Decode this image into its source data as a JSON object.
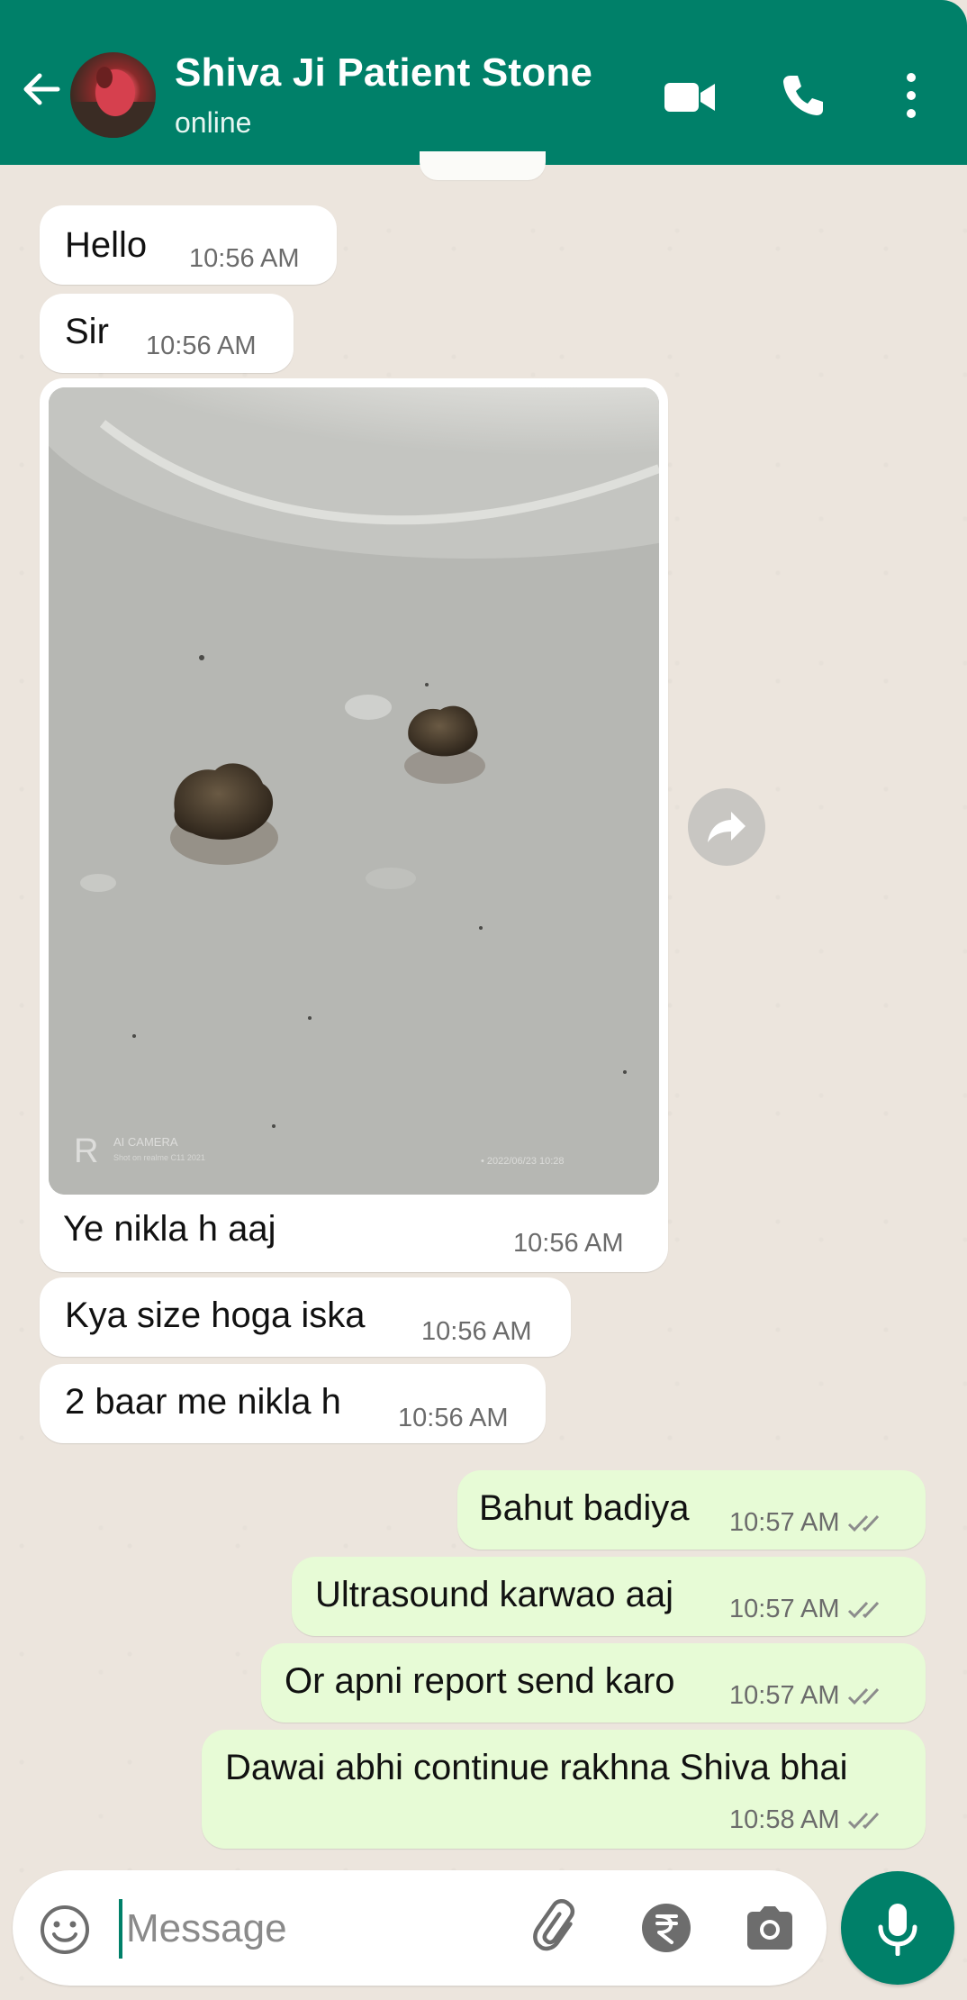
{
  "header": {
    "contact_name": "Shiva Ji Patient Stone",
    "status": "online",
    "icons": [
      "back-arrow-icon",
      "video-call-icon",
      "phone-call-icon",
      "more-options-icon"
    ],
    "color": "#008069"
  },
  "messages": [
    {
      "direction": "incoming",
      "text": "Hello",
      "time": "10:56 AM"
    },
    {
      "direction": "incoming",
      "text": "Sir",
      "time": "10:56 AM"
    },
    {
      "direction": "incoming",
      "type": "image",
      "caption": "Ye nikla h aaj",
      "time": "10:56 AM",
      "image_watermark": {
        "brand": "AI CAMERA",
        "sub": "Shot on realme C11 2021",
        "stamp": "2022/06/23  10:28"
      }
    },
    {
      "direction": "incoming",
      "text": "Kya size hoga iska",
      "time": "10:56 AM"
    },
    {
      "direction": "incoming",
      "text": "2 baar me nikla h",
      "time": "10:56 AM"
    },
    {
      "direction": "outgoing",
      "text": "Bahut badiya",
      "time": "10:57 AM",
      "read": true
    },
    {
      "direction": "outgoing",
      "text": "Ultrasound karwao aaj",
      "time": "10:57 AM",
      "read": true
    },
    {
      "direction": "outgoing",
      "text": "Or apni report send karo",
      "time": "10:57 AM",
      "read": true
    },
    {
      "direction": "outgoing",
      "text": "Dawai abhi continue rakhna Shiva bhai",
      "time": "10:58 AM",
      "read": true
    }
  ],
  "composer": {
    "placeholder": "Message",
    "icons": [
      "emoji-icon",
      "attach-icon",
      "rupee-payment-icon",
      "camera-icon",
      "mic-icon"
    ]
  },
  "colors": {
    "incoming_bubble": "#ffffff",
    "outgoing_bubble": "#e7fbd6",
    "wallpaper": "#ece5dd",
    "accent": "#008069"
  }
}
